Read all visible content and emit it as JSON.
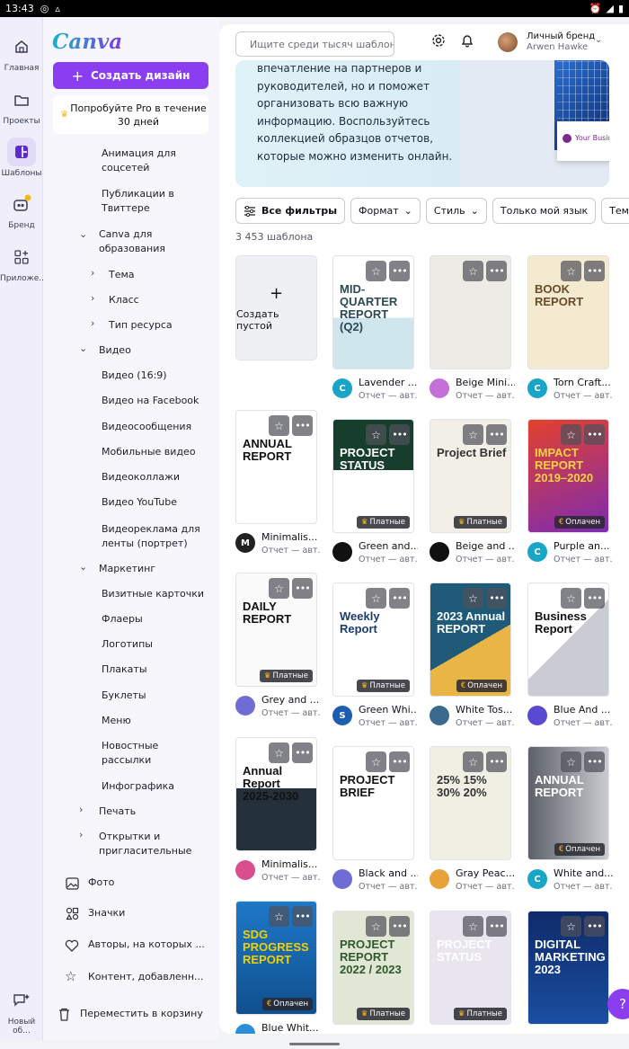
{
  "status": {
    "time": "13:43"
  },
  "rail": [
    {
      "label": "Главная",
      "icon": "home-icon"
    },
    {
      "label": "Проекты",
      "icon": "folder-icon"
    },
    {
      "label": "Шаблоны",
      "icon": "templates-icon"
    },
    {
      "label": "Бренд",
      "icon": "brand-icon"
    },
    {
      "label": "Приложе...",
      "icon": "apps-icon"
    },
    {
      "label": "Новый об...",
      "icon": "whats-new-icon"
    }
  ],
  "sidebar": {
    "logo": "Canva",
    "create_button": "Создать дизайн",
    "pro_promo": "Попробуйте Pro в течение 30 дней",
    "items": [
      "Анимация для соцсетей",
      "Публикации в Твиттере",
      "Canva для образования",
      "Тема",
      "Класс",
      "Тип ресурса",
      "Видео",
      "Видео (16:9)",
      "Видео на Facebook",
      "Видеосообщения",
      "Мобильные видео",
      "Видеоколлажи",
      "Видео YouTube",
      "Видеореклама для ленты (портрет)",
      "Маркетинг",
      "Визитные карточки",
      "Флаеры",
      "Логотипы",
      "Плакаты",
      "Буклеты",
      "Меню",
      "Новостные рассылки",
      "Инфографика",
      "Печать",
      "Открытки и пригласительные",
      "Фото",
      "Значки",
      "Авторы, на которых ...",
      "Контент, добавленн...",
      "Переместить в корзину"
    ]
  },
  "header": {
    "search_placeholder": "Ищите среди тысяч шаблонов",
    "brand_name": "Личный бренд",
    "user_name": "Arwen Hawke"
  },
  "hero": {
    "text": "впечатление на партнеров и руководителей, но и поможет организовать всю важную информацию. Воспользуйтесь коллекцией образцов отчетов, которые можно изменить онлайн.",
    "image_caption": "Your Busin"
  },
  "filters": [
    "Все фильтры",
    "Формат",
    "Стиль",
    "Только мой язык",
    "Тема"
  ],
  "count_label": "3 453 шаблона",
  "blank_label": "Создать пустой",
  "templates": [
    {
      "title": "Lavender ...",
      "sub": "Отчет — авт...",
      "badge": "",
      "avatar": "C",
      "thumb_text": "MID-QUARTER REPORT (Q2)",
      "avatar_color": "#18a5c8"
    },
    {
      "title": "Beige Mini...",
      "sub": "Отчет — авт...",
      "badge": "",
      "avatar": "",
      "thumb_text": "",
      "avatar_color": "#c56fd8"
    },
    {
      "title": "Torn Craft...",
      "sub": "Отчет — авт...",
      "badge": "",
      "avatar": "C",
      "thumb_text": "BOOK REPORT",
      "avatar_color": "#18a5c8"
    },
    {
      "title": "Minimalis...",
      "sub": "Отчет — авт...",
      "badge": "",
      "avatar": "M",
      "thumb_text": "ANNUAL REPORT",
      "avatar_color": "#222"
    },
    {
      "title": "Green and...",
      "sub": "Отчет — авт...",
      "badge": "Платные",
      "avatar": "",
      "thumb_text": "PROJECT STATUS REPORT",
      "avatar_color": "#111"
    },
    {
      "title": "Beige and ...",
      "sub": "Отчет — авт...",
      "badge": "Платные",
      "avatar": "",
      "thumb_text": "Project Brief",
      "avatar_color": "#111"
    },
    {
      "title": "Purple an...",
      "sub": "Отчет — авт...",
      "badge": "Оплачен",
      "avatar": "C",
      "thumb_text": "IMPACT REPORT 2019–2020",
      "avatar_color": "#18a5c8"
    },
    {
      "title": "Grey and ...",
      "sub": "Отчет — авт...",
      "badge": "Платные",
      "avatar": "",
      "thumb_text": "DAILY REPORT",
      "avatar_color": "#6f6dd3"
    },
    {
      "title": "Green Whi...",
      "sub": "Отчет — авт...",
      "badge": "Платные",
      "avatar": "S",
      "thumb_text": "Weekly Report",
      "avatar_color": "#1c5fb0"
    },
    {
      "title": "White Tos...",
      "sub": "Отчет — авт...",
      "badge": "Оплачен",
      "avatar": "",
      "thumb_text": "2023 Annual REPORT",
      "avatar_color": "#3a6b8c"
    },
    {
      "title": "Blue And ...",
      "sub": "Отчет — авт...",
      "badge": "",
      "avatar": "",
      "thumb_text": "Business Report",
      "avatar_color": "#5a4ad1"
    },
    {
      "title": "Minimalis...",
      "sub": "Отчет — авт...",
      "badge": "",
      "avatar": "",
      "thumb_text": "Annual Report 2025-2030",
      "avatar_color": "#d94f8e"
    },
    {
      "title": "Black and ...",
      "sub": "Отчет — авт...",
      "badge": "",
      "avatar": "",
      "thumb_text": "PROJECT BRIEF",
      "avatar_color": "#6f6dd3"
    },
    {
      "title": "Gray Peac...",
      "sub": "Отчет — авт...",
      "badge": "",
      "avatar": "",
      "thumb_text": "25% 15% 30% 20%",
      "avatar_color": "#e8a23a"
    },
    {
      "title": "White and...",
      "sub": "Отчет — авт...",
      "badge": "Оплачен",
      "avatar": "C",
      "thumb_text": "ANNUAL REPORT",
      "avatar_color": "#18a5c8"
    },
    {
      "title": "Blue Whit...",
      "sub": "",
      "badge": "Оплачен",
      "avatar": "",
      "thumb_text": "SDG PROGRESS REPORT",
      "avatar_color": "#2a8fd8"
    },
    {
      "title": "",
      "sub": "",
      "badge": "Платные",
      "avatar": "",
      "thumb_text": "PROJECT REPORT 2022 / 2023",
      "avatar_color": "#555"
    },
    {
      "title": "",
      "sub": "",
      "badge": "Платные",
      "avatar": "",
      "thumb_text": "PROJECT STATUS",
      "avatar_color": "#555"
    },
    {
      "title": "",
      "sub": "",
      "badge": "",
      "avatar": "",
      "thumb_text": "DIGITAL MARKETING 2023",
      "avatar_color": "#555"
    }
  ],
  "help_label": "?"
}
